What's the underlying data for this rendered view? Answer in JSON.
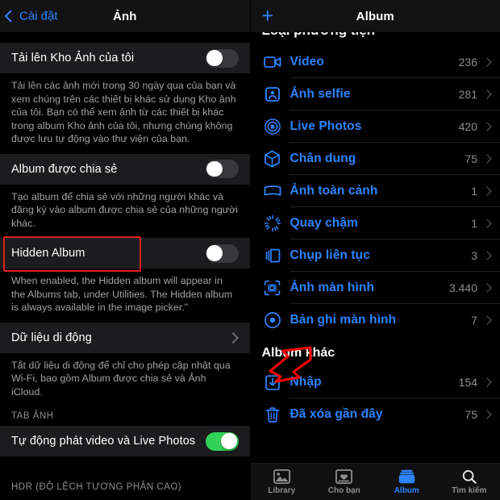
{
  "left_panel": {
    "nav": {
      "back_label": "Cài đặt",
      "title": "Ảnh",
      "back_icon": "chevron-left-icon"
    },
    "rows": [
      {
        "label": "Tải lên Kho Ảnh của tôi",
        "type": "toggle",
        "state": "off",
        "footnote": "Tải lên các ảnh mới trong 30 ngày qua của bạn và xem chúng trên các thiết bị khác sử dụng Kho ảnh của tôi. Bạn có thể xem ảnh từ các thiết bị khác trong album Kho ảnh của tôi, nhưng chúng không được lưu tự động vào thư viện của bạn."
      },
      {
        "label": "Album được chia sẻ",
        "type": "toggle",
        "state": "off",
        "footnote": "Tạo album để chia sẻ với những người khác và đăng ký vào album được chia sẻ của những người khác."
      },
      {
        "label": "Hidden Album",
        "type": "toggle",
        "state": "off",
        "highlighted": true,
        "footnote": "When enabled, the Hidden album will appear in the Albums tab, under Utilities. The Hidden album is always available in the image picker.\""
      },
      {
        "label": "Dữ liệu di động",
        "type": "disclosure",
        "footnote": "Tắt dữ liệu di động để chỉ cho phép cập nhật qua Wi-Fi, bao gồm Album được chia sẻ và Ảnh iCloud."
      }
    ],
    "section_tab_anh": "TAB ẢNH",
    "autoplay_row": {
      "label": "Tự động phát video và Live Photos",
      "type": "toggle",
      "state": "on"
    },
    "section_hdr": "HDR (ĐỘ LỆCH TƯƠNG PHẢN CAO)",
    "highlight_color": "#e02020"
  },
  "right_panel": {
    "nav": {
      "add_icon": "plus-icon",
      "title": "Album"
    },
    "clipped_section_header": "Loại phương tiện",
    "media_albums": [
      {
        "name": "Video",
        "count": "236",
        "icon": "video-camera-icon"
      },
      {
        "name": "Ảnh selfie",
        "count": "281",
        "icon": "selfie-person-icon"
      },
      {
        "name": "Live Photos",
        "count": "420",
        "icon": "live-photos-icon"
      },
      {
        "name": "Chân dung",
        "count": "75",
        "icon": "portrait-cube-icon"
      },
      {
        "name": "Ảnh toàn cảnh",
        "count": "1",
        "icon": "panorama-icon"
      },
      {
        "name": "Quay chậm",
        "count": "1",
        "icon": "slow-motion-icon"
      },
      {
        "name": "Chụp liên tục",
        "count": "3",
        "icon": "burst-icon"
      },
      {
        "name": "Ảnh màn hình",
        "count": "3.440",
        "icon": "screenshot-icon"
      },
      {
        "name": "Bản ghi màn hình",
        "count": "7",
        "icon": "screen-record-icon"
      }
    ],
    "other_group_title": "Album khác",
    "other_albums": [
      {
        "name": "Nhập",
        "count": "154",
        "icon": "import-icon",
        "annotated": true
      },
      {
        "name": "Đã xóa gần đây",
        "count": "75",
        "icon": "trash-icon"
      }
    ],
    "tabs": [
      {
        "label": "Library",
        "icon": "photos-library-icon",
        "active": false
      },
      {
        "label": "Cho bạn",
        "icon": "for-you-icon",
        "active": false
      },
      {
        "label": "Album",
        "icon": "albums-icon",
        "active": true
      },
      {
        "label": "Tìm kiếm",
        "icon": "search-icon",
        "active": false
      }
    ],
    "accent_color": "#2e84ff",
    "annotation_color": "#ff0000"
  }
}
